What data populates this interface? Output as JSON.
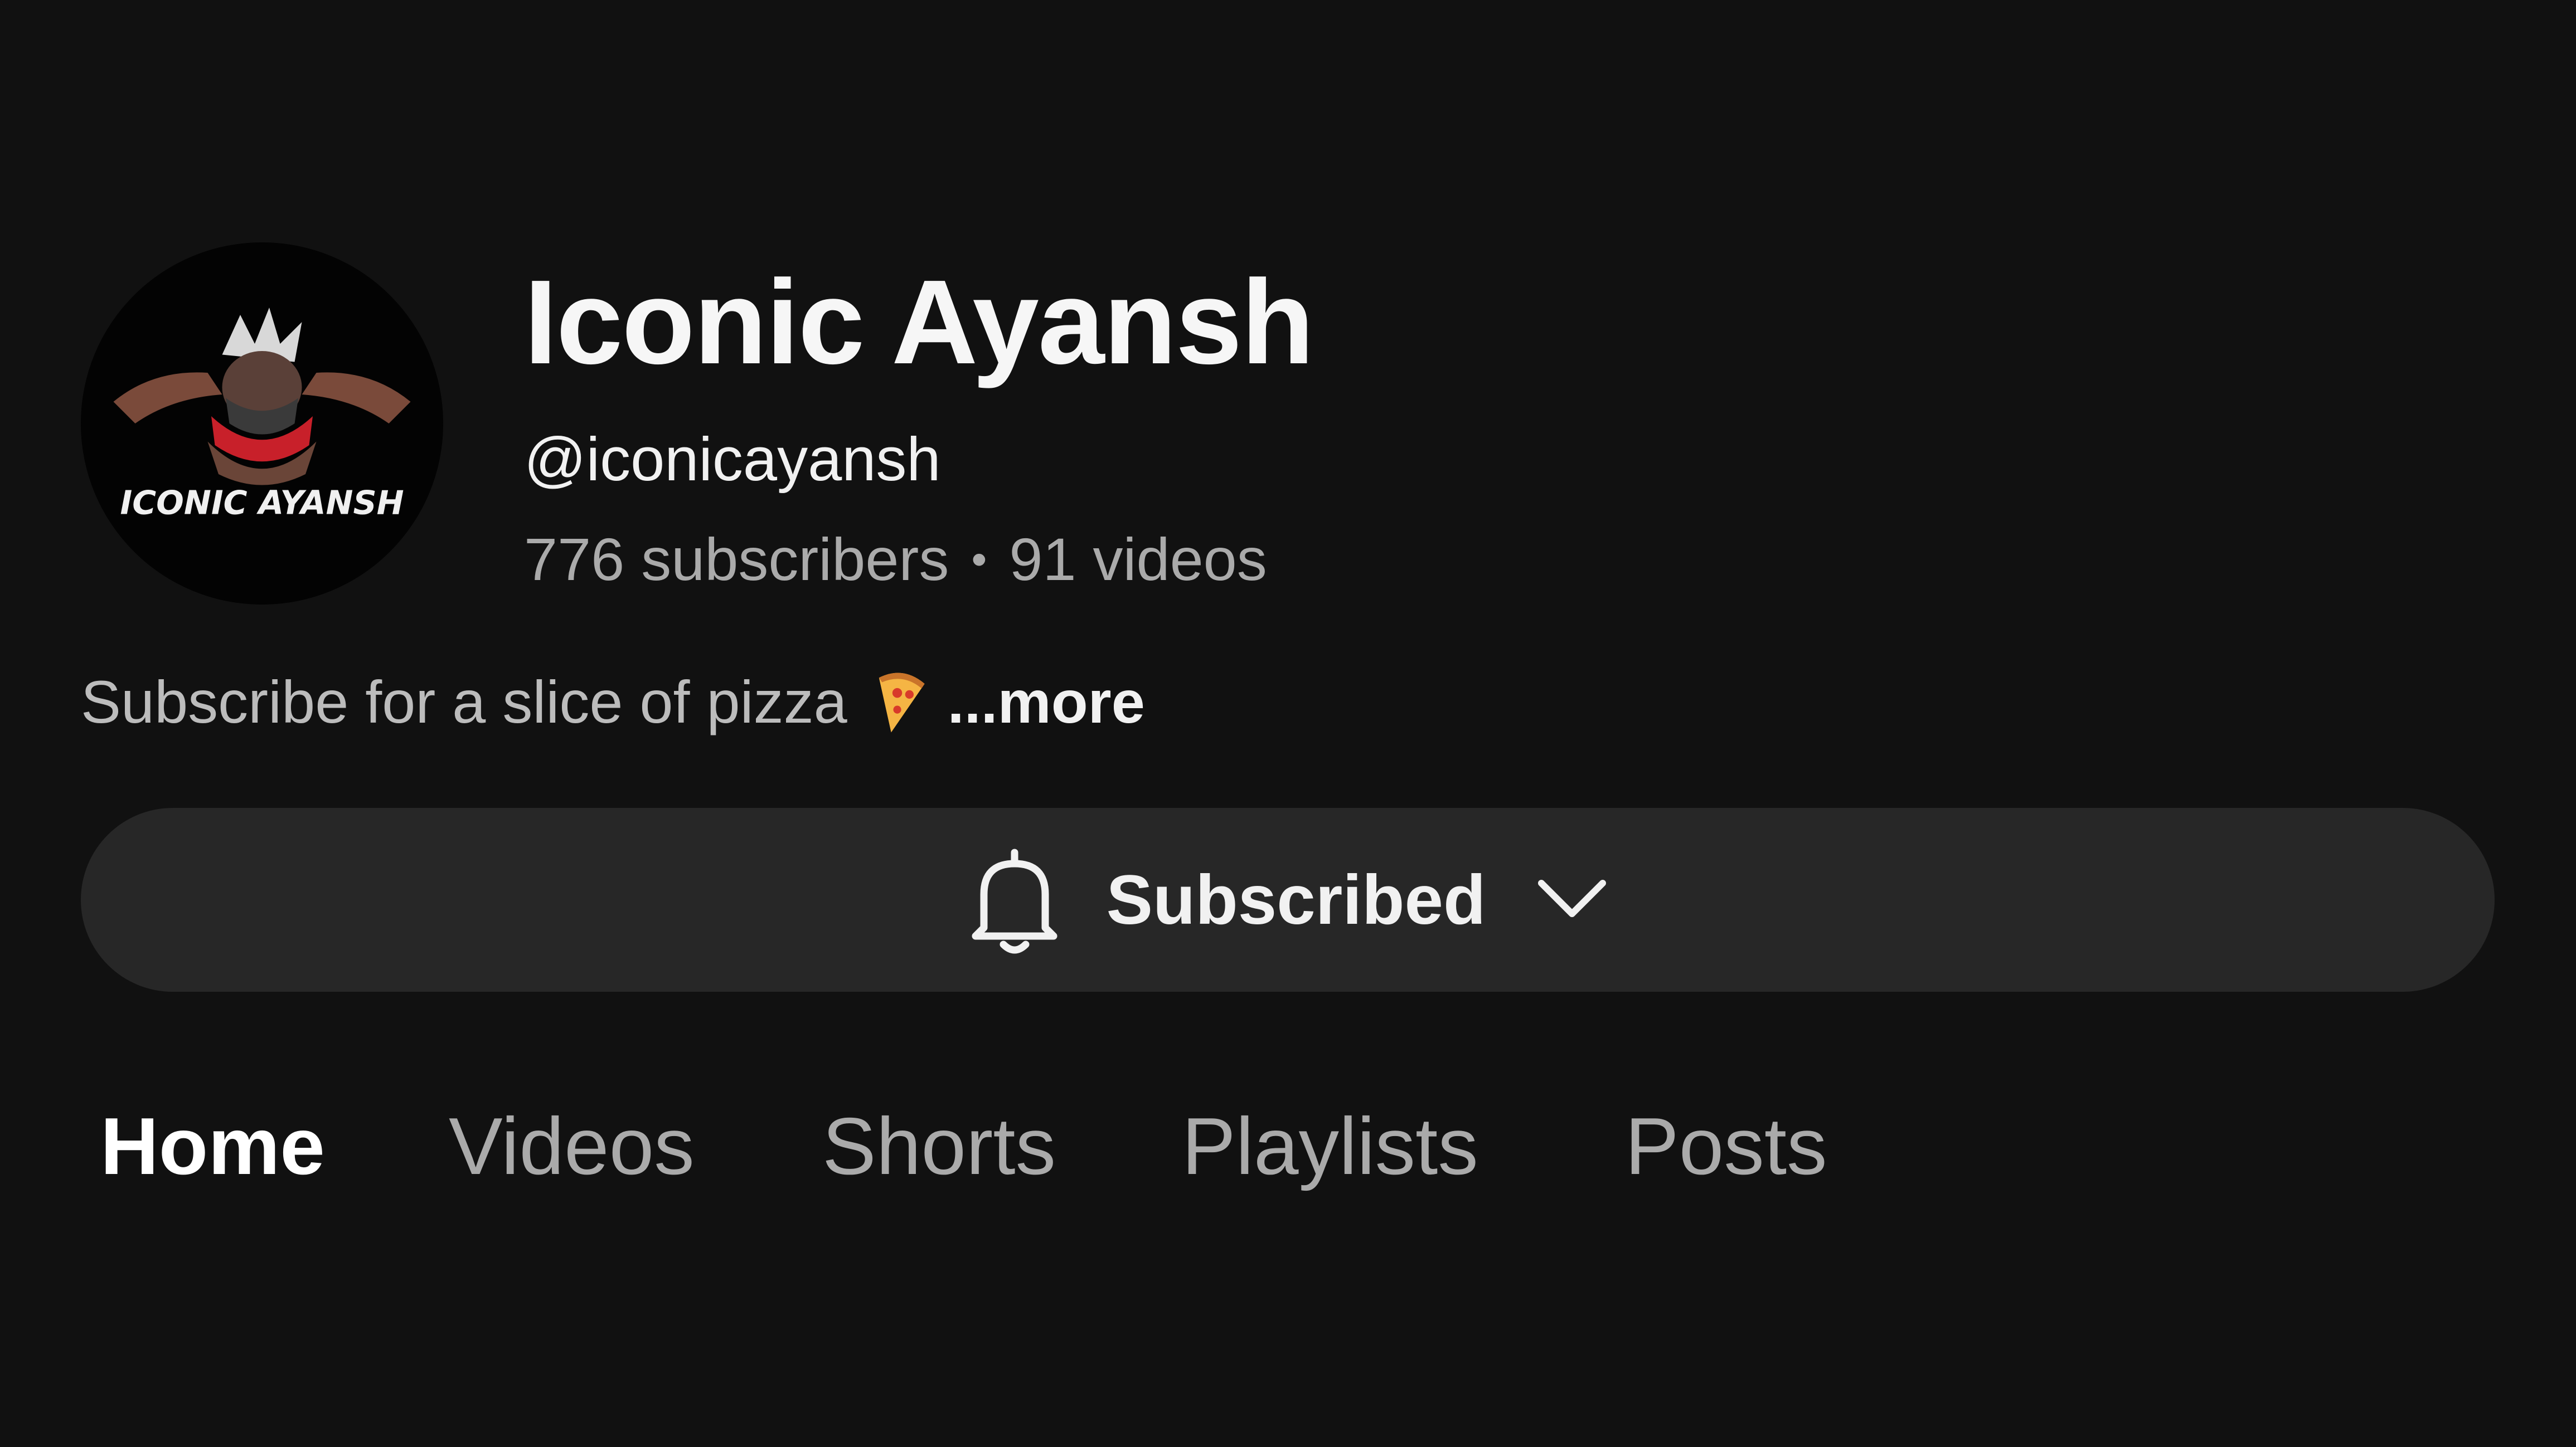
{
  "channel": {
    "name": "Iconic Ayansh",
    "handle": "@iconicayansh",
    "subscribers": "776 subscribers",
    "separator": "•",
    "videos": "91 videos",
    "avatar_logo_text": "ICONIC AYANSH"
  },
  "description": {
    "text": "Subscribe for a slice of pizza",
    "emoji_icon": "pizza-icon",
    "more_label": "...more"
  },
  "subscribe": {
    "label": "Subscribed",
    "icon": "bell-icon",
    "dropdown_icon": "chevron-down-icon"
  },
  "tabs": [
    {
      "label": "Home",
      "active": true
    },
    {
      "label": "Videos",
      "active": false
    },
    {
      "label": "Shorts",
      "active": false
    },
    {
      "label": "Playlists",
      "active": false
    },
    {
      "label": "Posts",
      "active": false
    }
  ],
  "colors": {
    "background": "#111111",
    "button_bg": "#272727",
    "text_primary": "#f1f1f1",
    "text_secondary": "#aaaaaa"
  }
}
